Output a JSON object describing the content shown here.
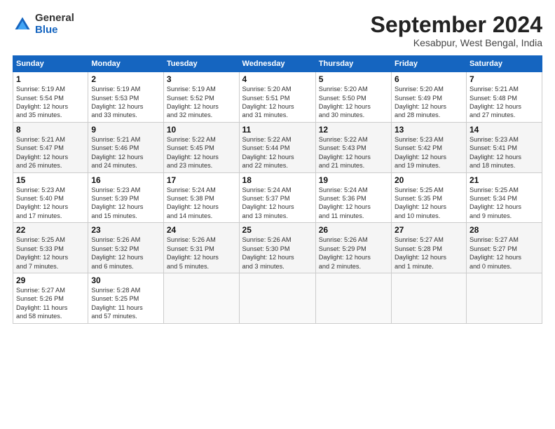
{
  "header": {
    "logo_line1": "General",
    "logo_line2": "Blue",
    "month": "September 2024",
    "location": "Kesabpur, West Bengal, India"
  },
  "weekdays": [
    "Sunday",
    "Monday",
    "Tuesday",
    "Wednesday",
    "Thursday",
    "Friday",
    "Saturday"
  ],
  "weeks": [
    [
      {
        "day": "1",
        "info": "Sunrise: 5:19 AM\nSunset: 5:54 PM\nDaylight: 12 hours\nand 35 minutes."
      },
      {
        "day": "2",
        "info": "Sunrise: 5:19 AM\nSunset: 5:53 PM\nDaylight: 12 hours\nand 33 minutes."
      },
      {
        "day": "3",
        "info": "Sunrise: 5:19 AM\nSunset: 5:52 PM\nDaylight: 12 hours\nand 32 minutes."
      },
      {
        "day": "4",
        "info": "Sunrise: 5:20 AM\nSunset: 5:51 PM\nDaylight: 12 hours\nand 31 minutes."
      },
      {
        "day": "5",
        "info": "Sunrise: 5:20 AM\nSunset: 5:50 PM\nDaylight: 12 hours\nand 30 minutes."
      },
      {
        "day": "6",
        "info": "Sunrise: 5:20 AM\nSunset: 5:49 PM\nDaylight: 12 hours\nand 28 minutes."
      },
      {
        "day": "7",
        "info": "Sunrise: 5:21 AM\nSunset: 5:48 PM\nDaylight: 12 hours\nand 27 minutes."
      }
    ],
    [
      {
        "day": "8",
        "info": "Sunrise: 5:21 AM\nSunset: 5:47 PM\nDaylight: 12 hours\nand 26 minutes."
      },
      {
        "day": "9",
        "info": "Sunrise: 5:21 AM\nSunset: 5:46 PM\nDaylight: 12 hours\nand 24 minutes."
      },
      {
        "day": "10",
        "info": "Sunrise: 5:22 AM\nSunset: 5:45 PM\nDaylight: 12 hours\nand 23 minutes."
      },
      {
        "day": "11",
        "info": "Sunrise: 5:22 AM\nSunset: 5:44 PM\nDaylight: 12 hours\nand 22 minutes."
      },
      {
        "day": "12",
        "info": "Sunrise: 5:22 AM\nSunset: 5:43 PM\nDaylight: 12 hours\nand 21 minutes."
      },
      {
        "day": "13",
        "info": "Sunrise: 5:23 AM\nSunset: 5:42 PM\nDaylight: 12 hours\nand 19 minutes."
      },
      {
        "day": "14",
        "info": "Sunrise: 5:23 AM\nSunset: 5:41 PM\nDaylight: 12 hours\nand 18 minutes."
      }
    ],
    [
      {
        "day": "15",
        "info": "Sunrise: 5:23 AM\nSunset: 5:40 PM\nDaylight: 12 hours\nand 17 minutes."
      },
      {
        "day": "16",
        "info": "Sunrise: 5:23 AM\nSunset: 5:39 PM\nDaylight: 12 hours\nand 15 minutes."
      },
      {
        "day": "17",
        "info": "Sunrise: 5:24 AM\nSunset: 5:38 PM\nDaylight: 12 hours\nand 14 minutes."
      },
      {
        "day": "18",
        "info": "Sunrise: 5:24 AM\nSunset: 5:37 PM\nDaylight: 12 hours\nand 13 minutes."
      },
      {
        "day": "19",
        "info": "Sunrise: 5:24 AM\nSunset: 5:36 PM\nDaylight: 12 hours\nand 11 minutes."
      },
      {
        "day": "20",
        "info": "Sunrise: 5:25 AM\nSunset: 5:35 PM\nDaylight: 12 hours\nand 10 minutes."
      },
      {
        "day": "21",
        "info": "Sunrise: 5:25 AM\nSunset: 5:34 PM\nDaylight: 12 hours\nand 9 minutes."
      }
    ],
    [
      {
        "day": "22",
        "info": "Sunrise: 5:25 AM\nSunset: 5:33 PM\nDaylight: 12 hours\nand 7 minutes."
      },
      {
        "day": "23",
        "info": "Sunrise: 5:26 AM\nSunset: 5:32 PM\nDaylight: 12 hours\nand 6 minutes."
      },
      {
        "day": "24",
        "info": "Sunrise: 5:26 AM\nSunset: 5:31 PM\nDaylight: 12 hours\nand 5 minutes."
      },
      {
        "day": "25",
        "info": "Sunrise: 5:26 AM\nSunset: 5:30 PM\nDaylight: 12 hours\nand 3 minutes."
      },
      {
        "day": "26",
        "info": "Sunrise: 5:26 AM\nSunset: 5:29 PM\nDaylight: 12 hours\nand 2 minutes."
      },
      {
        "day": "27",
        "info": "Sunrise: 5:27 AM\nSunset: 5:28 PM\nDaylight: 12 hours\nand 1 minute."
      },
      {
        "day": "28",
        "info": "Sunrise: 5:27 AM\nSunset: 5:27 PM\nDaylight: 12 hours\nand 0 minutes."
      }
    ],
    [
      {
        "day": "29",
        "info": "Sunrise: 5:27 AM\nSunset: 5:26 PM\nDaylight: 11 hours\nand 58 minutes."
      },
      {
        "day": "30",
        "info": "Sunrise: 5:28 AM\nSunset: 5:25 PM\nDaylight: 11 hours\nand 57 minutes."
      },
      {
        "day": "",
        "info": ""
      },
      {
        "day": "",
        "info": ""
      },
      {
        "day": "",
        "info": ""
      },
      {
        "day": "",
        "info": ""
      },
      {
        "day": "",
        "info": ""
      }
    ]
  ]
}
